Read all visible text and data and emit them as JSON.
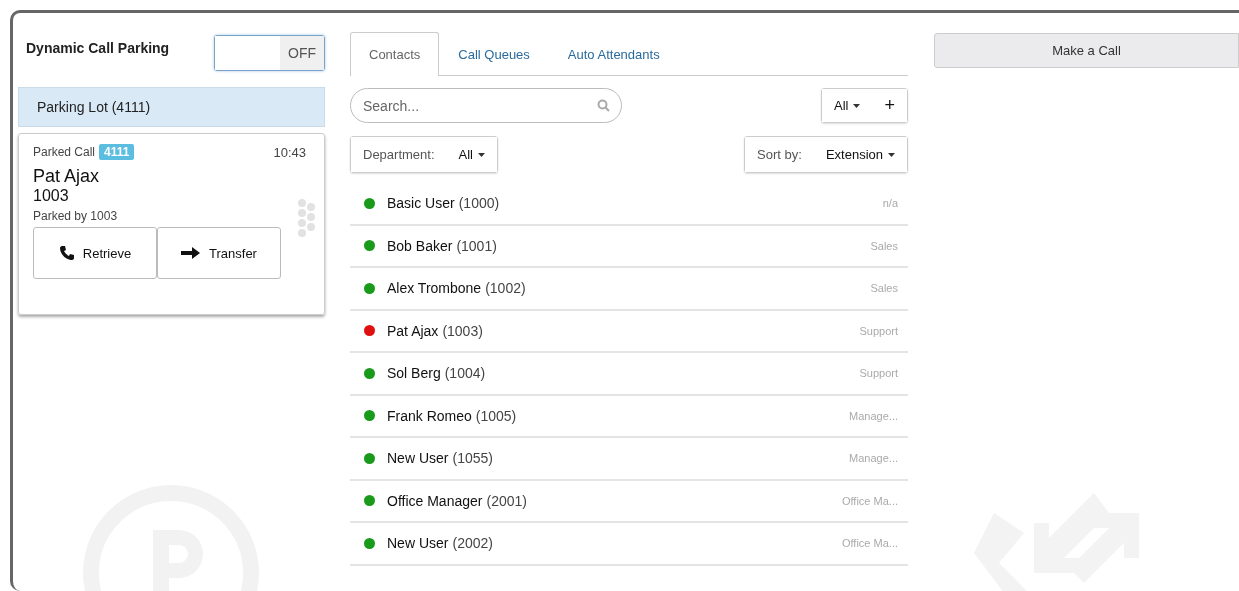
{
  "parking": {
    "label": "Dynamic Call Parking",
    "toggle": {
      "on": false,
      "text": "OFF"
    },
    "lot": "Parking Lot (4111)",
    "call": {
      "label": "Parked Call",
      "badge": "4111",
      "time": "10:43",
      "name": "Pat Ajax",
      "number": "1003",
      "parked_by": "Parked by 1003",
      "buttons": [
        {
          "kind": "retrieve",
          "label": "Retrieve"
        },
        {
          "kind": "transfer",
          "label": "Transfer"
        }
      ]
    }
  },
  "tabs": [
    {
      "label": "Contacts",
      "selected": true
    },
    {
      "label": "Call Queues",
      "selected": false
    },
    {
      "label": "Auto Attendants",
      "selected": false
    }
  ],
  "search": {
    "placeholder": "Search..."
  },
  "filter": {
    "label": "All",
    "add": "+"
  },
  "department": {
    "label": "Department:",
    "value": "All"
  },
  "sort": {
    "label": "Sort by:",
    "value": "Extension"
  },
  "contacts": [
    {
      "name": "Basic User",
      "ext": "(1000)",
      "dept": "n/a",
      "color": "#1a9a1a"
    },
    {
      "name": "Bob Baker",
      "ext": "(1001)",
      "dept": "Sales",
      "color": "#1a9a1a"
    },
    {
      "name": "Alex Trombone",
      "ext": "(1002)",
      "dept": "Sales",
      "color": "#1a9a1a"
    },
    {
      "name": "Pat Ajax",
      "ext": "(1003)",
      "dept": "Support",
      "color": "#e01010"
    },
    {
      "name": "Sol Berg",
      "ext": "(1004)",
      "dept": "Support",
      "color": "#1a9a1a"
    },
    {
      "name": "Frank Romeo",
      "ext": "(1005)",
      "dept": "Manage...",
      "color": "#1a9a1a"
    },
    {
      "name": "New User",
      "ext": "(1055)",
      "dept": "Manage...",
      "color": "#1a9a1a"
    },
    {
      "name": "Office Manager",
      "ext": "(2001)",
      "dept": "Office Ma...",
      "color": "#1a9a1a"
    },
    {
      "name": "New User",
      "ext": "(2002)",
      "dept": "Office Ma...",
      "color": "#1a9a1a"
    }
  ],
  "make_call": "Make a Call"
}
